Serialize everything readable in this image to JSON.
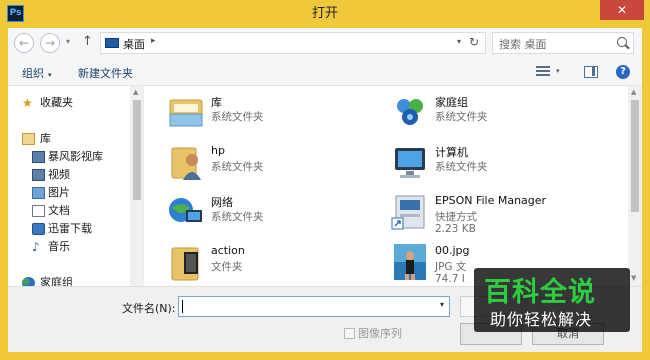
{
  "window": {
    "title": "打开",
    "app_icon": "Ps",
    "close": "✕"
  },
  "nav": {
    "back": "←",
    "forward": "→",
    "recent": "▾",
    "up": "↑",
    "address": "桌面",
    "address_sep": "▸",
    "address_dropdown": "▾",
    "refresh": "↻",
    "search_placeholder": "搜索 桌面"
  },
  "toolbar": {
    "organize": "组织",
    "new_folder": "新建文件夹",
    "caret": "▾"
  },
  "navpane": {
    "items": [
      {
        "label": "收藏夹",
        "icon": "star-icon"
      },
      {
        "label": "库",
        "icon": "library-icon"
      },
      {
        "label": "暴风影视库",
        "icon": "video-library-icon"
      },
      {
        "label": "视频",
        "icon": "video-icon"
      },
      {
        "label": "图片",
        "icon": "picture-icon"
      },
      {
        "label": "文档",
        "icon": "document-icon"
      },
      {
        "label": "迅雷下载",
        "icon": "download-icon"
      },
      {
        "label": "音乐",
        "icon": "music-icon"
      },
      {
        "label": "家庭组",
        "icon": "homegroup-icon"
      }
    ]
  },
  "files": [
    {
      "name": "库",
      "meta": "系统文件夹",
      "icon": "library-folder-icon"
    },
    {
      "name": "家庭组",
      "meta": "系统文件夹",
      "icon": "homegroup-icon"
    },
    {
      "name": "hp",
      "meta": "系统文件夹",
      "icon": "user-folder-icon"
    },
    {
      "name": "计算机",
      "meta": "系统文件夹",
      "icon": "computer-icon"
    },
    {
      "name": "网络",
      "meta": "系统文件夹",
      "icon": "network-icon"
    },
    {
      "name": "EPSON File Manager",
      "meta": "快捷方式",
      "meta2": "2.23 KB",
      "icon": "shortcut-icon"
    },
    {
      "name": "action",
      "meta": "文件夹",
      "icon": "folder-icon"
    },
    {
      "name": "00.jpg",
      "meta": "JPG 文",
      "meta2": "74.7 I",
      "icon": "image-file-icon"
    }
  ],
  "bottom": {
    "filename_label": "文件名(N):",
    "filename_value": "",
    "image_sequence": "图像序列",
    "cancel": "取消"
  },
  "watermark": {
    "title": "百科全说",
    "subtitle": "助你轻松解决"
  },
  "colors": {
    "frame": "#f0c93b",
    "close": "#c9473b",
    "accent": "#2ecc40"
  }
}
